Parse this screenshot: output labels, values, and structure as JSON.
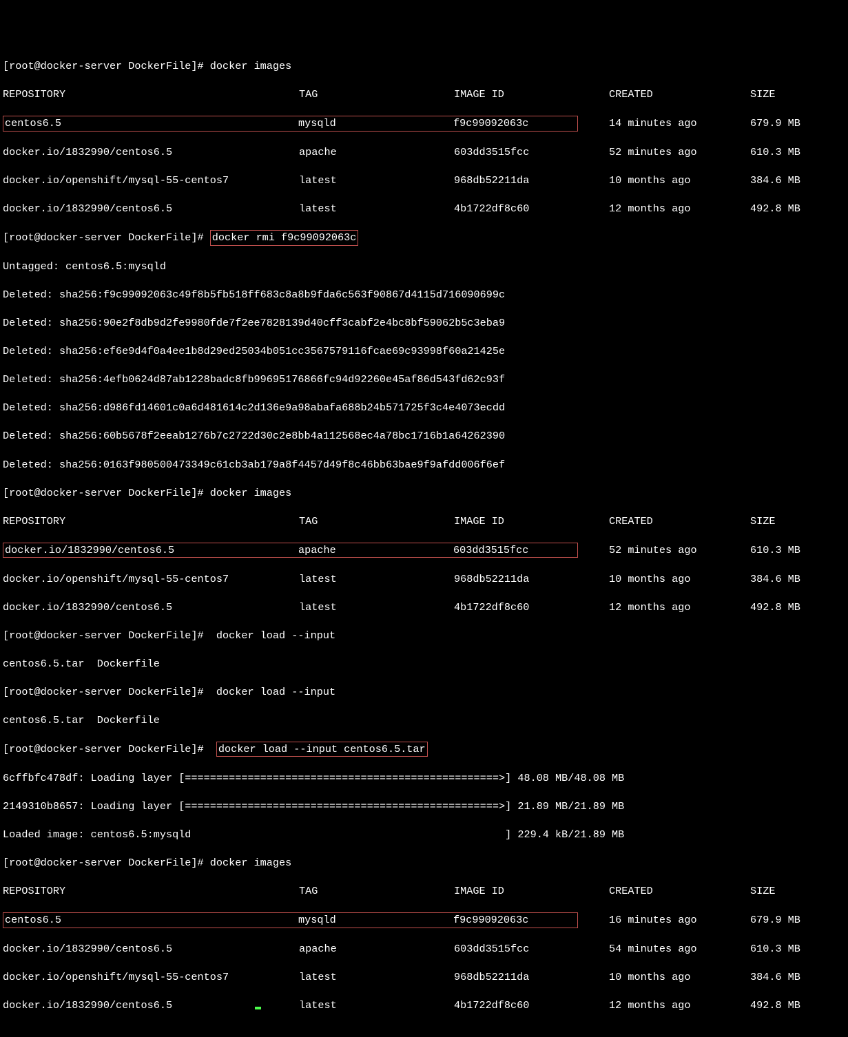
{
  "prompt": "[root@docker-server DockerFile]# ",
  "cmd_images": "docker images",
  "cmd_rmi": "docker rmi f9c99092063c",
  "cmd_load_partial": "docker load --input",
  "cmd_load_full": "docker load --input centos6.5.tar",
  "tab_files": "centos6.5.tar  Dockerfile",
  "hdr": {
    "repo": "REPOSITORY",
    "tag": "TAG",
    "id": "IMAGE ID",
    "crt": "CREATED",
    "size": "SIZE"
  },
  "t1": [
    {
      "repo": "centos6.5",
      "tag": "mysqld",
      "id": "f9c99092063c",
      "crt": "14 minutes ago",
      "size": "679.9 MB"
    },
    {
      "repo": "docker.io/1832990/centos6.5",
      "tag": "apache",
      "id": "603dd3515fcc",
      "crt": "52 minutes ago",
      "size": "610.3 MB"
    },
    {
      "repo": "docker.io/openshift/mysql-55-centos7",
      "tag": "latest",
      "id": "968db52211da",
      "crt": "10 months ago",
      "size": "384.6 MB"
    },
    {
      "repo": "docker.io/1832990/centos6.5",
      "tag": "latest",
      "id": "4b1722df8c60",
      "crt": "12 months ago",
      "size": "492.8 MB"
    }
  ],
  "rmi_out": [
    "Untagged: centos6.5:mysqld",
    "Deleted: sha256:f9c99092063c49f8b5fb518ff683c8a8b9fda6c563f90867d4115d716090699c",
    "Deleted: sha256:90e2f8db9d2fe9980fde7f2ee7828139d40cff3cabf2e4bc8bf59062b5c3eba9",
    "Deleted: sha256:ef6e9d4f0a4ee1b8d29ed25034b051cc3567579116fcae69c93998f60a21425e",
    "Deleted: sha256:4efb0624d87ab1228badc8fb99695176866fc94d92260e45af86d543fd62c93f",
    "Deleted: sha256:d986fd14601c0a6d481614c2d136e9a98abafa688b24b571725f3c4e4073ecdd",
    "Deleted: sha256:60b5678f2eeab1276b7c2722d30c2e8bb4a112568ec4a78bc1716b1a64262390",
    "Deleted: sha256:0163f980500473349c61cb3ab179a8f4457d49f8c46bb63bae9f9afdd006f6ef"
  ],
  "t2": [
    {
      "repo": "docker.io/1832990/centos6.5",
      "tag": "apache",
      "id": "603dd3515fcc",
      "crt": "52 minutes ago",
      "size": "610.3 MB"
    },
    {
      "repo": "docker.io/openshift/mysql-55-centos7",
      "tag": "latest",
      "id": "968db52211da",
      "crt": "10 months ago",
      "size": "384.6 MB"
    },
    {
      "repo": "docker.io/1832990/centos6.5",
      "tag": "latest",
      "id": "4b1722df8c60",
      "crt": "12 months ago",
      "size": "492.8 MB"
    }
  ],
  "load_out": [
    "6cffbfc478df: Loading layer [==================================================>] 48.08 MB/48.08 MB",
    "2149310b8657: Loading layer [==================================================>] 21.89 MB/21.89 MB",
    "Loaded image: centos6.5:mysqld                                                  ] 229.4 kB/21.89 MB"
  ],
  "t3": [
    {
      "repo": "centos6.5",
      "tag": "mysqld",
      "id": "f9c99092063c",
      "crt": "16 minutes ago",
      "size": "679.9 MB"
    },
    {
      "repo": "docker.io/1832990/centos6.5",
      "tag": "apache",
      "id": "603dd3515fcc",
      "crt": "54 minutes ago",
      "size": "610.3 MB"
    },
    {
      "repo": "docker.io/openshift/mysql-55-centos7",
      "tag": "latest",
      "id": "968db52211da",
      "crt": "10 months ago",
      "size": "384.6 MB"
    },
    {
      "repo": "docker.io/1832990/centos6.5",
      "tag": "latest",
      "id": "4b1722df8c60",
      "crt": "12 months ago",
      "size": "492.8 MB"
    }
  ]
}
